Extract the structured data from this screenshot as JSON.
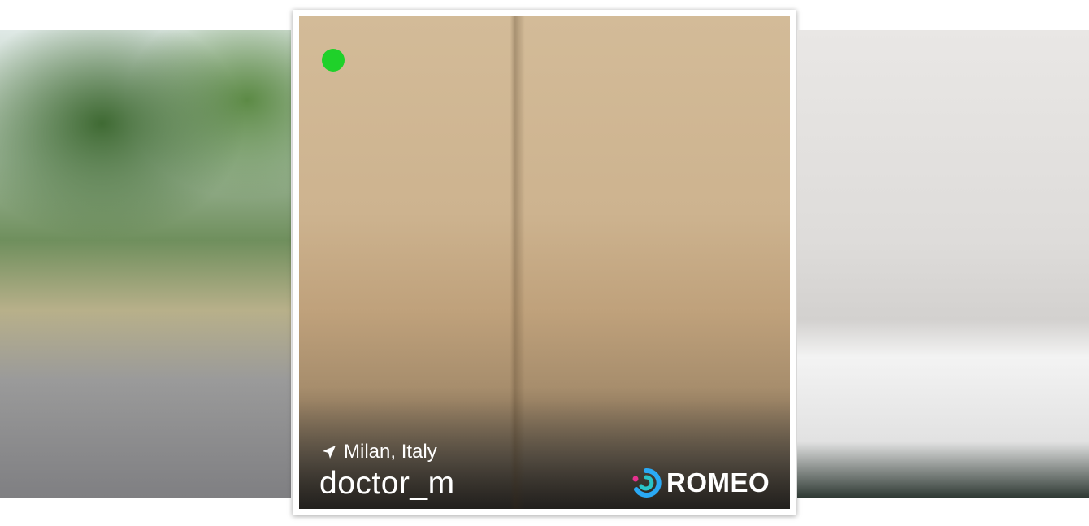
{
  "profile": {
    "location": "Milan, Italy",
    "username": "doctor_m",
    "online": true
  },
  "brand": {
    "name": "ROMEO"
  },
  "icons": {
    "location": "location-arrow-icon",
    "brand_logo": "romeo-logo-icon",
    "online": "online-status-icon"
  },
  "colors": {
    "online": "#1fd12a",
    "text": "#ffffff",
    "logo_blue": "#2aa9f5",
    "logo_pink": "#e6318f",
    "logo_teal": "#29c3c8"
  }
}
